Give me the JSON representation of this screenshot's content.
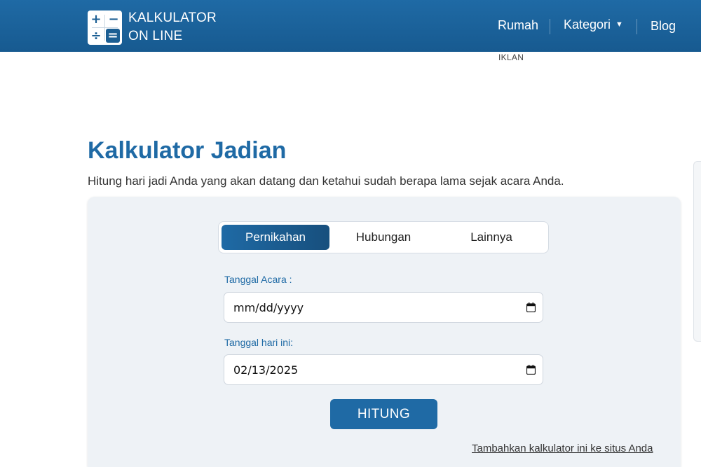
{
  "brand": {
    "line1": "KALKULATOR",
    "line2": "ON LINE",
    "icon_glyphs": [
      "+",
      "−",
      "÷",
      "="
    ]
  },
  "nav": {
    "home": "Rumah",
    "categories": "Kategori",
    "categories_caret": "▼",
    "blog": "Blog"
  },
  "ad_label": "IKLAN",
  "page": {
    "title": "Kalkulator Jadian",
    "description": "Hitung hari jadi Anda yang akan datang dan ketahui sudah berapa lama sejak acara Anda."
  },
  "tabs": [
    {
      "label": "Pernikahan",
      "active": true
    },
    {
      "label": "Hubungan",
      "active": false
    },
    {
      "label": "Lainnya",
      "active": false
    }
  ],
  "form": {
    "event_date_label": "Tanggal Acara :",
    "event_date_value": "mm/dd/yyyy",
    "today_label": "Tanggal hari ini:",
    "today_value": "02/13/2025",
    "submit_label": "HITUNG"
  },
  "embed_link": "Tambahkan kalkulator ini ke situs Anda",
  "colors": {
    "primary": "#1f6aa5",
    "card_bg": "#eef2f6",
    "header_bg": "#1f6aa5"
  },
  "icons": [
    "calendar-icon",
    "calendar-icon"
  ]
}
